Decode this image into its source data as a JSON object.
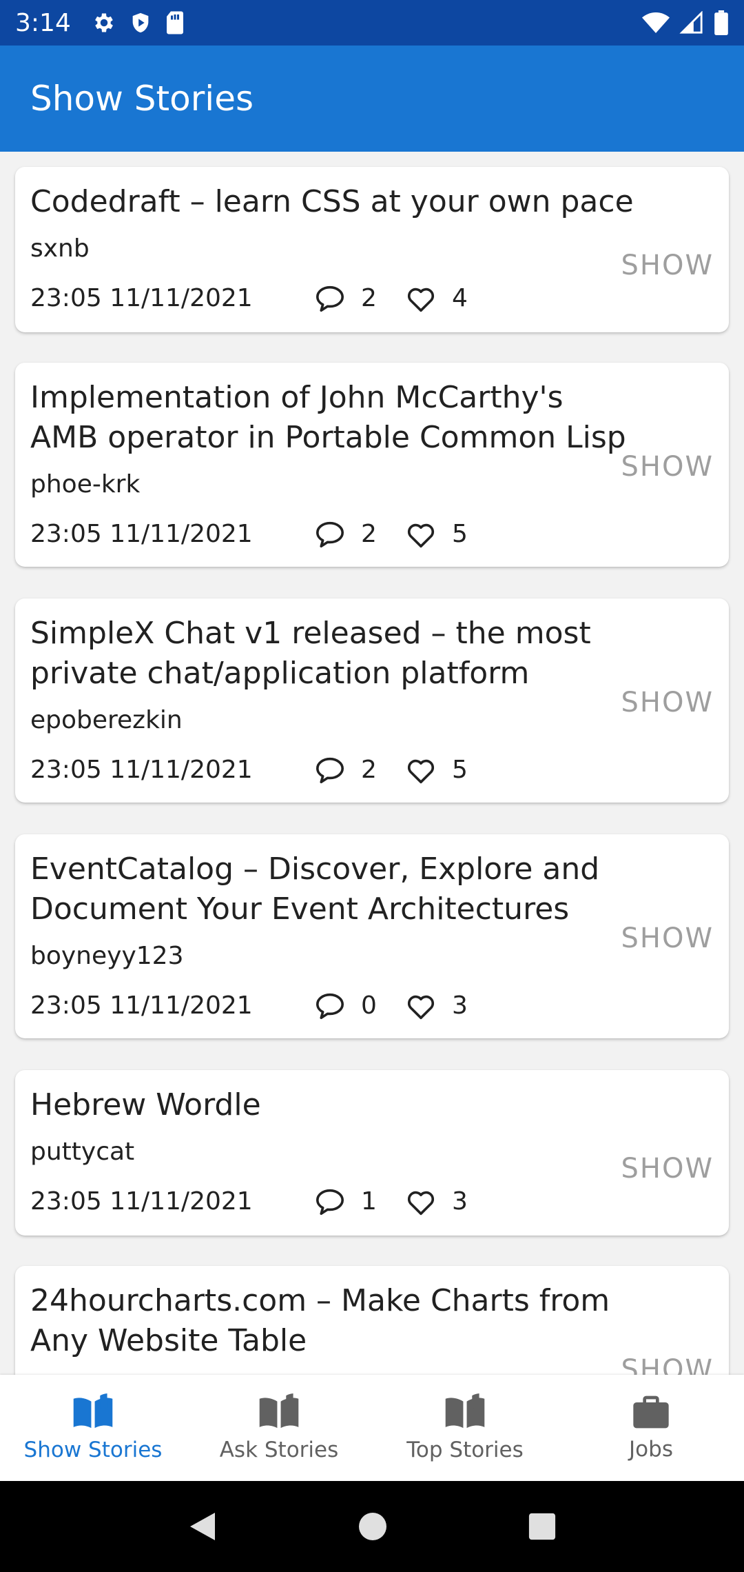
{
  "status_bar": {
    "time": "3:14",
    "icons_left": [
      "gear-icon",
      "shield-icon",
      "sd-card-icon"
    ],
    "icons_right": [
      "wifi-icon",
      "signal-icon",
      "battery-icon"
    ]
  },
  "app_bar": {
    "title": "Show Stories"
  },
  "stories": [
    {
      "title": "Codedraft – learn CSS at your own pace",
      "author": "sxnb",
      "time": "23:05 11/11/2021",
      "comments": "2",
      "likes": "4",
      "action": "SHOW"
    },
    {
      "title": "Implementation of John McCarthy's AMB operator in Portable Common Lisp",
      "author": "phoe-krk",
      "time": "23:05 11/11/2021",
      "comments": "2",
      "likes": "5",
      "action": "SHOW"
    },
    {
      "title": "SimpleX Chat v1 released – the most private chat/application platform",
      "author": "epoberezkin",
      "time": "23:05 11/11/2021",
      "comments": "2",
      "likes": "5",
      "action": "SHOW"
    },
    {
      "title": "EventCatalog – Discover, Explore and Document Your Event Architectures",
      "author": "boyneyy123",
      "time": "23:05 11/11/2021",
      "comments": "0",
      "likes": "3",
      "action": "SHOW"
    },
    {
      "title": "Hebrew Wordle",
      "author": "puttycat",
      "time": "23:05 11/11/2021",
      "comments": "1",
      "likes": "3",
      "action": "SHOW"
    },
    {
      "title": "24hourcharts.com – Make Charts from Any Website Table",
      "action": "SHOW"
    }
  ],
  "bottom_nav": [
    {
      "label": "Show Stories",
      "icon": "book-open-icon",
      "active": true
    },
    {
      "label": "Ask Stories",
      "icon": "book-open-icon",
      "active": false
    },
    {
      "label": "Top Stories",
      "icon": "book-open-icon",
      "active": false
    },
    {
      "label": "Jobs",
      "icon": "briefcase-icon",
      "active": false
    }
  ],
  "colors": {
    "status_bar": "#0d47a1",
    "app_bar": "#1976d2",
    "accent": "#1976d2",
    "inactive": "#616161"
  }
}
